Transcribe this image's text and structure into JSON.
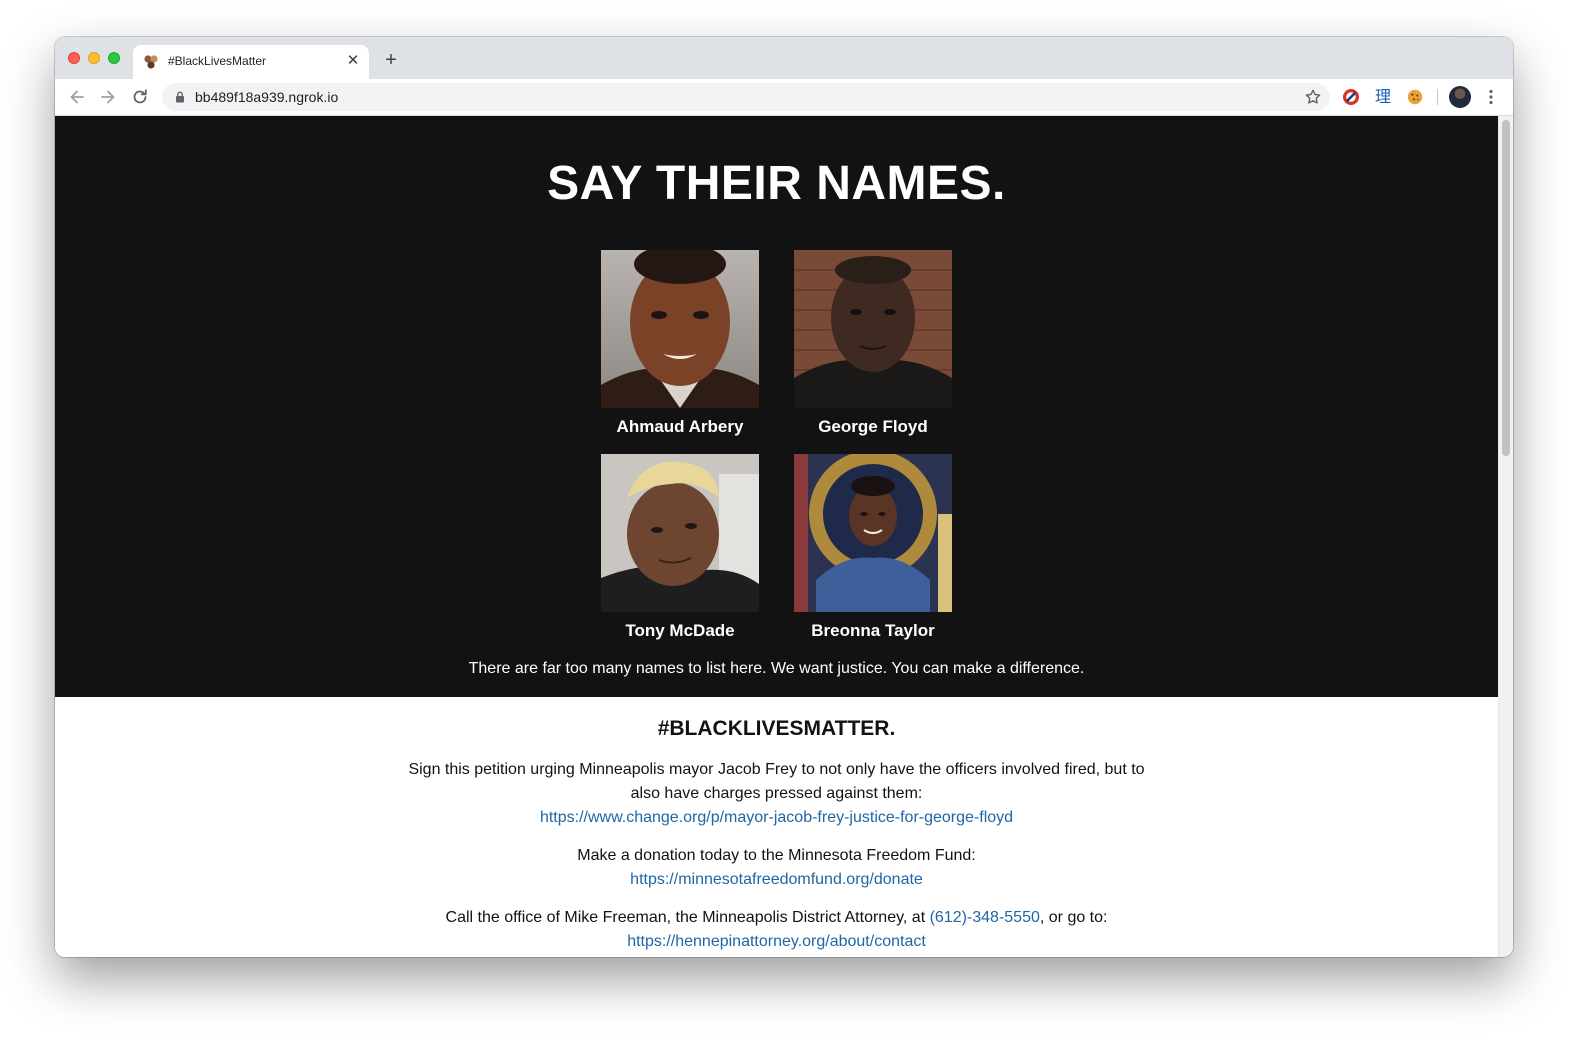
{
  "browser": {
    "tab": {
      "title": "#BlackLivesMatter",
      "close": "✕"
    },
    "new_tab": "+",
    "url": "bb489f18a939.ngrok.io",
    "icons": [
      "arrow-left-icon",
      "arrow-right-icon",
      "reload-icon",
      "lock-icon",
      "star-icon",
      "vertical-dots-icon"
    ],
    "extensions": [
      "red-circle-extension-icon",
      "chinese-character-extension-icon",
      "cookie-extension-icon"
    ],
    "extension_2_glyph": "理",
    "colors": {
      "tabstrip": "#dee1e6",
      "toolbar": "#ffffff",
      "omnibox": "#f1f3f4"
    }
  },
  "hero": {
    "title": "SAY THEIR NAMES.",
    "people": [
      {
        "name": "Ahmaud Arbery"
      },
      {
        "name": "George Floyd"
      },
      {
        "name": "Tony McDade"
      },
      {
        "name": "Breonna Taylor"
      }
    ],
    "subtitle": "There are far too many names to list here. We want justice. You can make a difference.",
    "background": "#121212"
  },
  "blm": {
    "title": "#BLACKLIVESMATTER.",
    "petition": {
      "text": "Sign this petition urging Minneapolis mayor Jacob Frey to not only have the officers involved fired, but to also have charges pressed against them:",
      "link": "https://www.change.org/p/mayor-jacob-frey-justice-for-george-floyd"
    },
    "donation": {
      "text": "Make a donation today to the Minnesota Freedom Fund:",
      "link": "https://minnesotafreedomfund.org/donate"
    },
    "call": {
      "text_before": "Call the office of Mike Freeman, the Minneapolis District Attorney, at ",
      "phone": "(612)-348-5550",
      "text_after": ", or go to:",
      "link": "https://hennepinattorney.org/about/contact"
    },
    "link_color": "#1e66a6"
  }
}
